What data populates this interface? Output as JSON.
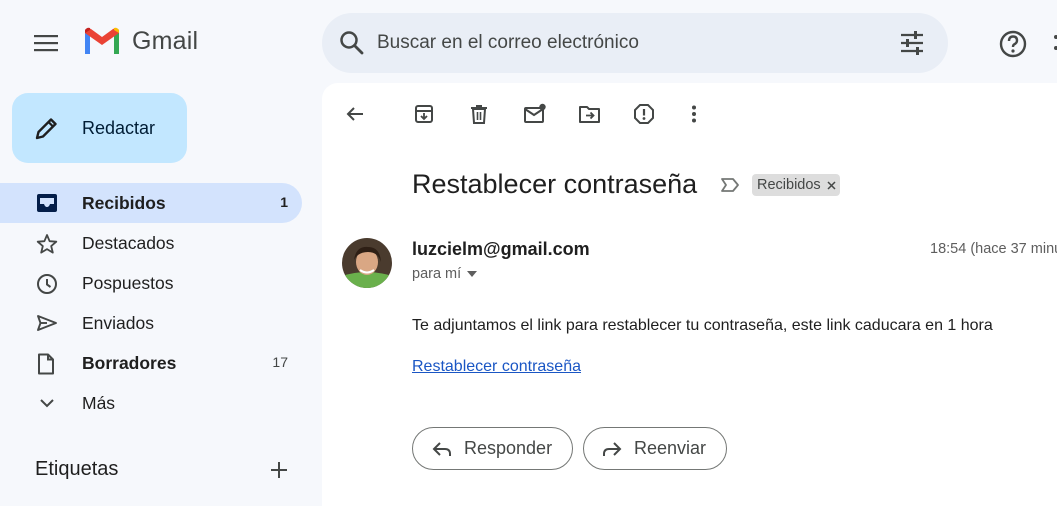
{
  "header": {
    "app_name": "Gmail",
    "search": {
      "placeholder": "Buscar en el correo electrónico"
    }
  },
  "compose": {
    "label": "Redactar"
  },
  "sidebar": {
    "items": [
      {
        "label": "Recibidos",
        "count": "1",
        "icon": "inbox-icon",
        "active": true,
        "bold": true
      },
      {
        "label": "Destacados",
        "count": "",
        "icon": "star-icon"
      },
      {
        "label": "Pospuestos",
        "count": "",
        "icon": "clock-icon"
      },
      {
        "label": "Enviados",
        "count": "",
        "icon": "send-icon"
      },
      {
        "label": "Borradores",
        "count": "17",
        "icon": "draft-icon",
        "bold": true
      },
      {
        "label": "Más",
        "count": "",
        "icon": "chevron-down-icon"
      }
    ],
    "labels_heading": "Etiquetas"
  },
  "email": {
    "subject": "Restablecer contraseña",
    "label_chip": "Recibidos",
    "sender": "luzcielm@gmail.com",
    "time": "18:54 (hace 37 minu",
    "recipient": "para mí",
    "body": "Te adjuntamos el link para restablecer tu contraseña, este link caducara en 1 hora",
    "link": "Restablecer contraseña"
  },
  "actions": {
    "reply": "Responder",
    "forward": "Reenviar"
  },
  "colors": {
    "background": "#f6f8fc",
    "compose_bg": "#c2e7ff",
    "active_nav": "#d3e3fd",
    "search_bg": "#e9eef6",
    "link": "#1a56c4"
  }
}
